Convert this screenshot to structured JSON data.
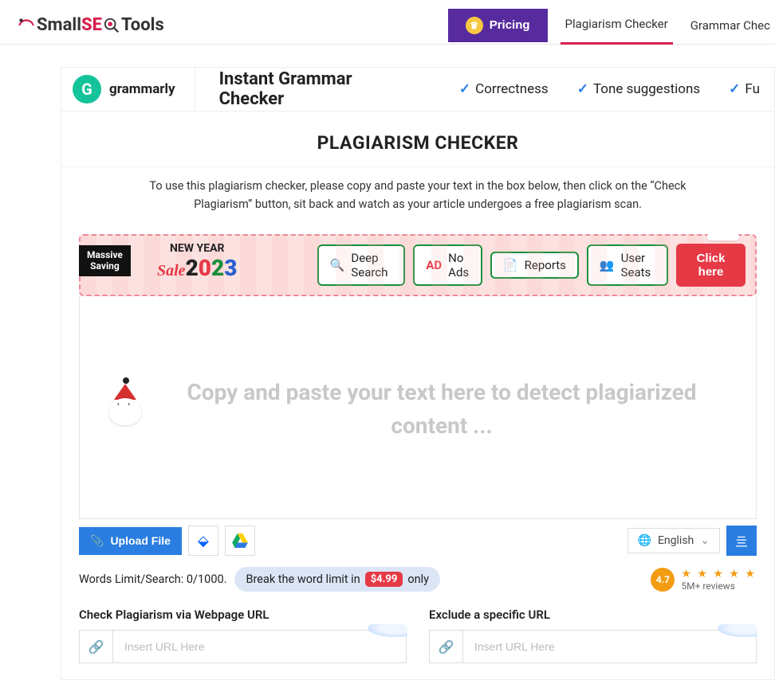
{
  "brand": {
    "small": "Small",
    "seo": "SE",
    "tools": "Tools"
  },
  "nav": {
    "pricing": "Pricing",
    "links": [
      "Plagiarism Checker",
      "Grammar Chec"
    ]
  },
  "grammarly": {
    "brand": "grammarly",
    "title": "Instant Grammar Checker",
    "features": [
      "Correctness",
      "Tone suggestions",
      "Fu"
    ]
  },
  "page": {
    "title": "PLAGIARISM CHECKER",
    "instructions": "To use this plagiarism checker, please copy and paste your text in the box below, then click on the “Check Plagiarism” button, sit back and watch as your article undergoes a free plagiarism scan."
  },
  "promo": {
    "tag_line1": "Massive",
    "tag_line2": "Saving",
    "new_year": "NEW YEAR",
    "sale": "Sale",
    "year_digits": [
      "2",
      "0",
      "2",
      "3"
    ],
    "pills": [
      "Deep Search",
      "No Ads",
      "Reports",
      "User Seats"
    ],
    "cta": "Click here"
  },
  "editor": {
    "placeholder": "Copy and paste your text here to detect plagiarized content ..."
  },
  "toolbar": {
    "upload": "Upload File",
    "language": "English"
  },
  "limit": {
    "label": "Words Limit/Search: 0/1000.",
    "break_prefix": "Break the word limit in",
    "price": "$4.99",
    "break_suffix": "only"
  },
  "reviews": {
    "rating": "4.7",
    "count": "5M+ reviews"
  },
  "urls": {
    "check_label": "Check Plagiarism via Webpage URL",
    "exclude_label": "Exclude a specific URL",
    "placeholder": "Insert URL Here"
  }
}
